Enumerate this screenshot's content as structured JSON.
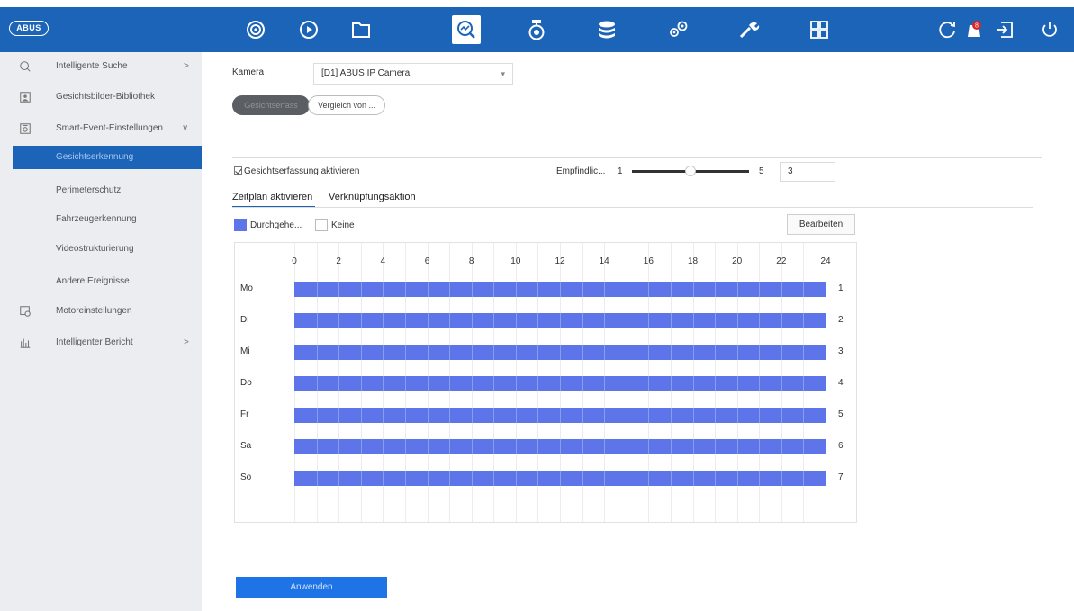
{
  "header": {
    "logo_text": "ABUS",
    "nav_icons": [
      "live-view-icon",
      "playback-icon",
      "files-icon",
      "search-analytics-icon",
      "camera-icon",
      "storage-icon",
      "settings-icon",
      "maintenance-icon",
      "layout-icon"
    ],
    "active_nav": "search-analytics-icon",
    "right_icons": [
      "refresh-icon",
      "alarm-icon",
      "logout-icon",
      "power-icon"
    ],
    "alarm_badge": "8"
  },
  "sidebar": {
    "items": [
      {
        "label": "Intelligente Suche",
        "icon": "search-icon",
        "chevron": ">"
      },
      {
        "label": "Gesichtsbilder-Bibliothek",
        "icon": "face-library-icon"
      },
      {
        "label": "Smart-Event-Einstellungen",
        "icon": "smart-event-icon",
        "chevron": "∨"
      },
      {
        "label": "Gesichtserkennung",
        "selected": true
      },
      {
        "label": "Perimeterschutz"
      },
      {
        "label": "Fahrzeugerkennung"
      },
      {
        "label": "Videostrukturierung"
      },
      {
        "label": "Andere Ereignisse"
      },
      {
        "label": "Motoreinstellungen",
        "icon": "motor-settings-icon"
      },
      {
        "label": "Intelligenter Bericht",
        "icon": "report-icon",
        "chevron": ">"
      }
    ]
  },
  "main": {
    "camera_label": "Kamera",
    "camera_value": "[D1] ABUS IP Camera",
    "mode_tabs": [
      "Gesichtserfass",
      "Vergleich von ..."
    ],
    "enable_face_detection": "Gesichtserfassung aktivieren",
    "sensitivity_label": "Empfindlic...",
    "sensitivity_min": "1",
    "sensitivity_max": "5",
    "sensitivity_value": "3",
    "tabs": [
      "Zeitplan aktivieren",
      "Verknüpfungsaktion"
    ],
    "legend_continuous": "Durchgehe...",
    "legend_none": "Keine",
    "edit_label": "Bearbeiten",
    "apply_label": "Anwenden"
  },
  "schedule": {
    "hours": [
      "0",
      "2",
      "4",
      "6",
      "8",
      "10",
      "12",
      "14",
      "16",
      "18",
      "20",
      "22",
      "24"
    ],
    "days": [
      "Mo",
      "Di",
      "Mi",
      "Do",
      "Fr",
      "Sa",
      "So"
    ],
    "row_numbers": [
      "1",
      "2",
      "3",
      "4",
      "5",
      "6",
      "7"
    ],
    "coverage_hours": [
      0,
      24
    ]
  },
  "colors": {
    "header_bg": "#1b64b8",
    "schedule_fill": "#5e74e9",
    "apply_bg": "#1e74e6",
    "sidebar_bg": "#ebedf0"
  }
}
